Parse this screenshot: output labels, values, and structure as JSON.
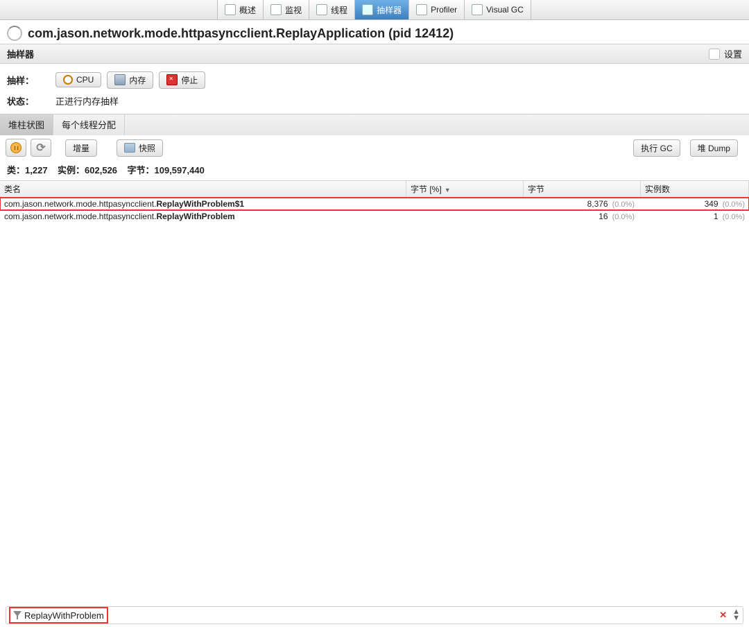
{
  "topTabs": {
    "t0": "概述",
    "t1": "监视",
    "t2": "线程",
    "t3": "抽样器",
    "t4": "Profiler",
    "t5": "Visual GC"
  },
  "title": "com.jason.network.mode.httpasyncclient.ReplayApplication (pid 12412)",
  "section": {
    "name": "抽样器",
    "settings": "设置"
  },
  "controls": {
    "sampleLabel": "抽样：",
    "cpu": "CPU",
    "mem": "内存",
    "stop": "停止",
    "statusLabel": "状态：",
    "statusValue": "正进行内存抽样"
  },
  "subtabs": {
    "heap": "堆柱状图",
    "thread": "每个线程分配"
  },
  "toolbar2": {
    "delta": "增量",
    "snapshot": "快照",
    "gc": "执行 GC",
    "dump": "堆 Dump"
  },
  "stats": {
    "classesLabel": "类：",
    "classes": "1,227",
    "instancesLabel": "实例：",
    "instances": "602,526",
    "bytesLabel": "字节：",
    "bytes": "109,597,440"
  },
  "columns": {
    "name": "类名",
    "bytesPct": "字节 [%]",
    "bytes": "字节",
    "instances": "实例数"
  },
  "rows": [
    {
      "pkg": "com.jason.network.mode.httpasyncclient.",
      "cls": "ReplayWithProblem$1",
      "bytes": "8,376",
      "bytesPct": "(0.0%)",
      "inst": "349",
      "instPct": "(0.0%)",
      "hl": true
    },
    {
      "pkg": "com.jason.network.mode.httpasyncclient.",
      "cls": "ReplayWithProblem",
      "bytes": "16",
      "bytesPct": "(0.0%)",
      "inst": "1",
      "instPct": "(0.0%)",
      "hl": false
    }
  ],
  "filter": "ReplayWithProblem"
}
